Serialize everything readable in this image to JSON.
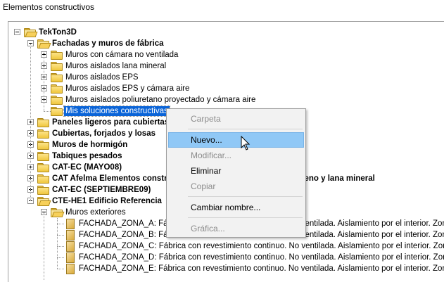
{
  "window": {
    "title": "Elementos constructivos"
  },
  "tree": {
    "rows": [
      {
        "label": "TekTon3D",
        "bold": true,
        "level": 0,
        "expander": "minus",
        "icon": "folder-open"
      },
      {
        "label": "Fachadas y muros de fábrica",
        "bold": true,
        "level": 1,
        "expander": "minus",
        "icon": "folder-open"
      },
      {
        "label": "Muros con cámara no ventilada",
        "bold": false,
        "level": 2,
        "expander": "plus",
        "icon": "folder"
      },
      {
        "label": "Muros aislados lana mineral",
        "bold": false,
        "level": 2,
        "expander": "plus",
        "icon": "folder"
      },
      {
        "label": "Muros aislados EPS",
        "bold": false,
        "level": 2,
        "expander": "plus",
        "icon": "folder"
      },
      {
        "label": "Muros aislados EPS y cámara aire",
        "bold": false,
        "level": 2,
        "expander": "plus",
        "icon": "folder"
      },
      {
        "label": "Muros aislados poliuretano proyectado y cámara aire",
        "bold": false,
        "level": 2,
        "expander": "plus",
        "icon": "folder"
      },
      {
        "label": "Mis soluciones constructivas",
        "bold": false,
        "level": 2,
        "expander": "none",
        "icon": "folder",
        "selected": true
      },
      {
        "label": "Paneles ligeros para cubiertas",
        "bold": true,
        "level": 1,
        "expander": "plus",
        "icon": "folder"
      },
      {
        "label": "Cubiertas, forjados y losas",
        "bold": true,
        "level": 1,
        "expander": "plus",
        "icon": "folder"
      },
      {
        "label": "Muros de hormigón",
        "bold": true,
        "level": 1,
        "expander": "plus",
        "icon": "folder"
      },
      {
        "label": "Tabiques pesados",
        "bold": true,
        "level": 1,
        "expander": "plus",
        "icon": "folder"
      },
      {
        "label": "CAT-EC (MAYO08)",
        "bold": true,
        "level": 1,
        "expander": "plus",
        "icon": "folder"
      },
      {
        "label": "CAT Afelma Elementos constructivos con aislamiento de poliestireno y lana mineral",
        "bold": true,
        "level": 1,
        "expander": "plus",
        "icon": "folder"
      },
      {
        "label": "CAT-EC (SEPTIEMBRE09)",
        "bold": true,
        "level": 1,
        "expander": "plus",
        "icon": "folder"
      },
      {
        "label": "CTE-HE1 Edificio Referencia",
        "bold": true,
        "level": 1,
        "expander": "minus",
        "icon": "folder-open"
      },
      {
        "label": "Muros exteriores",
        "bold": false,
        "level": 2,
        "expander": "minus",
        "icon": "folder-open"
      },
      {
        "label": "FACHADA_ZONA_A: Fábrica con revestimiento continuo. No ventilada. Aislamiento por el interior. Zona A",
        "bold": false,
        "level": 3,
        "expander": "none",
        "icon": "element"
      },
      {
        "label": "FACHADA_ZONA_B: Fábrica con revestimiento continuo. No ventilada. Aislamiento por el interior. Zona B",
        "bold": false,
        "level": 3,
        "expander": "none",
        "icon": "element"
      },
      {
        "label": "FACHADA_ZONA_C: Fábrica con revestimiento continuo. No ventilada. Aislamiento por el interior. Zona C",
        "bold": false,
        "level": 3,
        "expander": "none",
        "icon": "element"
      },
      {
        "label": "FACHADA_ZONA_D: Fábrica con revestimiento continuo. No ventilada. Aislamiento por el interior. Zona D",
        "bold": false,
        "level": 3,
        "expander": "none",
        "icon": "element"
      },
      {
        "label": "FACHADA_ZONA_E: Fábrica con revestimiento continuo. No ventilada. Aislamiento por el interior. Zona E",
        "bold": false,
        "level": 3,
        "expander": "none",
        "icon": "element"
      }
    ]
  },
  "context_menu": {
    "items": [
      {
        "label": "Carpeta",
        "disabled": true,
        "hover": false
      },
      {
        "separator": true
      },
      {
        "label": "Nuevo...",
        "disabled": false,
        "hover": true
      },
      {
        "label": "Modificar...",
        "disabled": true,
        "hover": false
      },
      {
        "label": "Eliminar",
        "disabled": false,
        "hover": false
      },
      {
        "label": "Copiar",
        "disabled": true,
        "hover": false
      },
      {
        "separator": true
      },
      {
        "label": "Cambiar nombre...",
        "disabled": false,
        "hover": false
      },
      {
        "separator": true
      },
      {
        "label": "Gráfica...",
        "disabled": true,
        "hover": false
      }
    ]
  },
  "colors": {
    "selection": "#0a64d8",
    "menu_hover": "#90c8f6",
    "disabled_text": "#8c8c8c",
    "folder": "#f0c73e"
  }
}
